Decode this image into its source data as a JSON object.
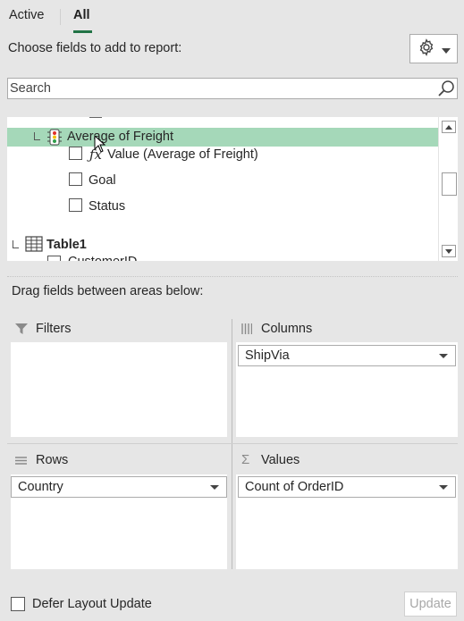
{
  "tabs": [
    {
      "label": "Active"
    },
    {
      "label": "All"
    }
  ],
  "header": {
    "choose_label": "Choose fields to add to report:",
    "settings_icon": "gear-icon"
  },
  "search": {
    "placeholder": "Search",
    "value": ""
  },
  "field_list": {
    "highlighted_item": "Average of Freight",
    "kpi_children": [
      {
        "label": "Value (Average of Freight)",
        "checked": false
      },
      {
        "label": "Goal",
        "checked": false
      },
      {
        "label": "Status",
        "checked": false
      }
    ],
    "table": "Table1",
    "partial_next": "CustomerID"
  },
  "drag_label": "Drag fields between areas below:",
  "areas": {
    "filters": {
      "title": "Filters",
      "items": []
    },
    "columns": {
      "title": "Columns",
      "items": [
        "ShipVia"
      ]
    },
    "rows": {
      "title": "Rows",
      "items": [
        "Country"
      ]
    },
    "values": {
      "title": "Values",
      "items": [
        "Count of OrderID"
      ]
    }
  },
  "footer": {
    "defer_label": "Defer Layout Update",
    "update_label": "Update"
  },
  "colors": {
    "accent": "#217346",
    "highlight": "#a5d8b9",
    "background": "#e6e6e6"
  }
}
